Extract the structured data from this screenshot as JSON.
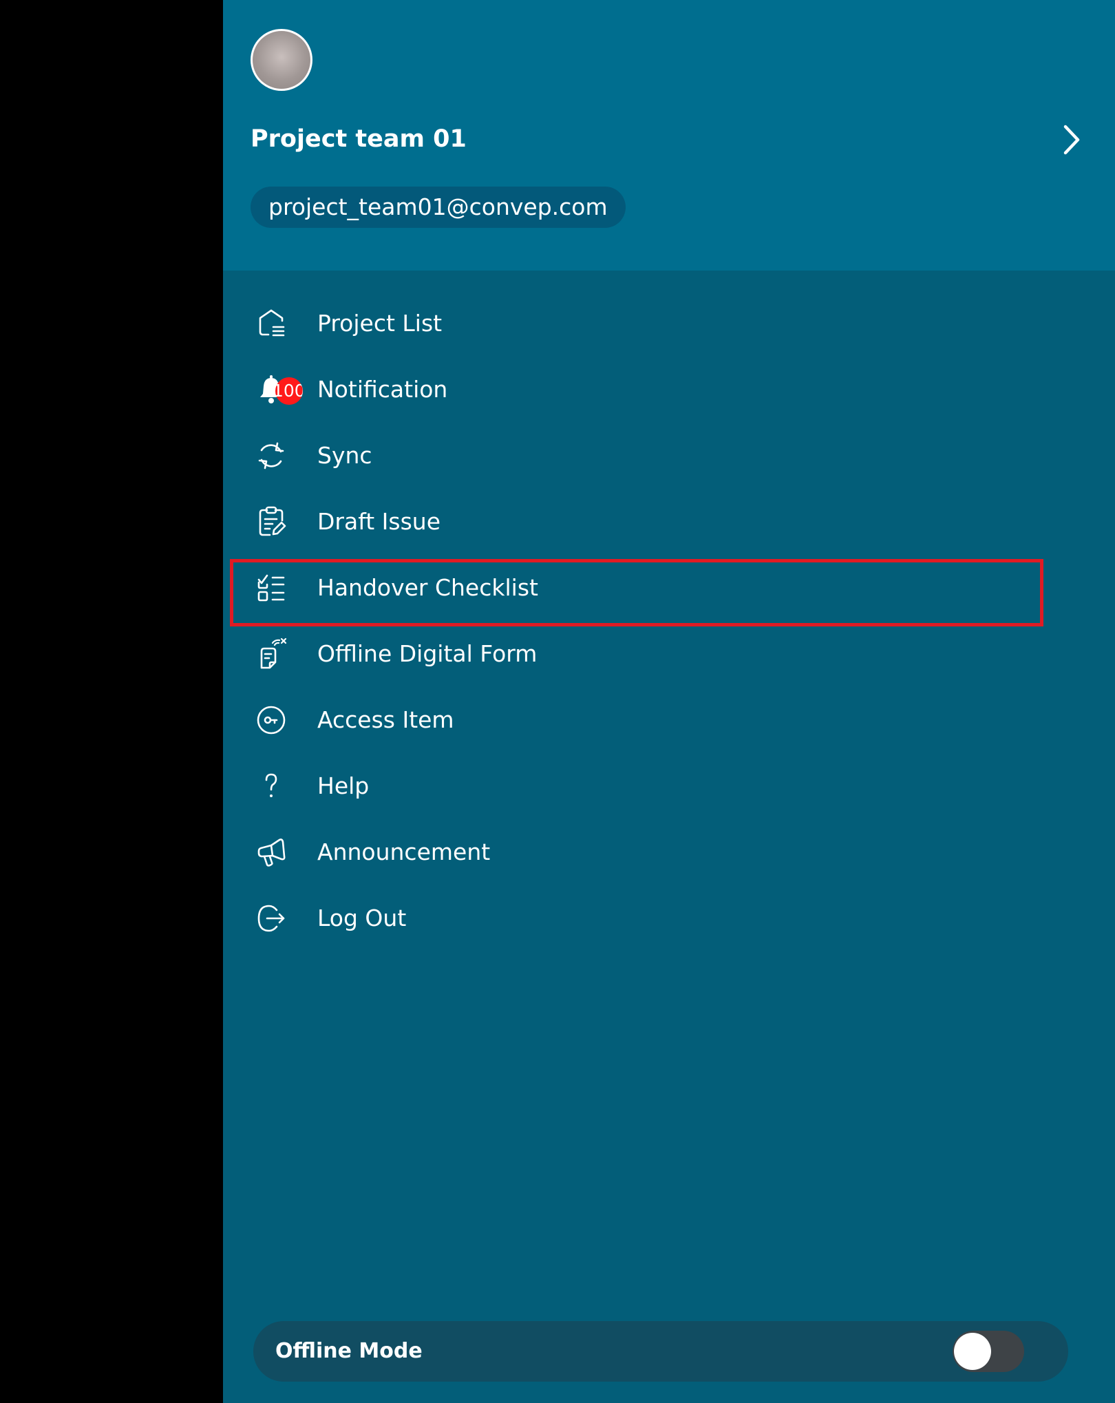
{
  "profile": {
    "name": "Project team 01",
    "email": "project_team01@convep.com"
  },
  "menu": {
    "items": [
      {
        "label": "Project List",
        "icon": "project-list-icon"
      },
      {
        "label": "Notification",
        "icon": "bell-icon",
        "badge": "100"
      },
      {
        "label": "Sync",
        "icon": "sync-icon"
      },
      {
        "label": "Draft Issue",
        "icon": "draft-issue-icon"
      },
      {
        "label": "Handover Checklist",
        "icon": "checklist-icon",
        "highlighted": true
      },
      {
        "label": "Offline Digital Form",
        "icon": "offline-form-icon"
      },
      {
        "label": "Access Item",
        "icon": "access-item-icon"
      },
      {
        "label": "Help",
        "icon": "help-icon"
      },
      {
        "label": "Announcement",
        "icon": "megaphone-icon"
      },
      {
        "label": "Log Out",
        "icon": "logout-icon"
      }
    ]
  },
  "offline_mode": {
    "label": "Offline Mode",
    "enabled": false
  },
  "colors": {
    "header_bg": "#006e8f",
    "drawer_bg": "#035e79",
    "highlight": "#e01b24",
    "badge": "#ff1a1a"
  }
}
